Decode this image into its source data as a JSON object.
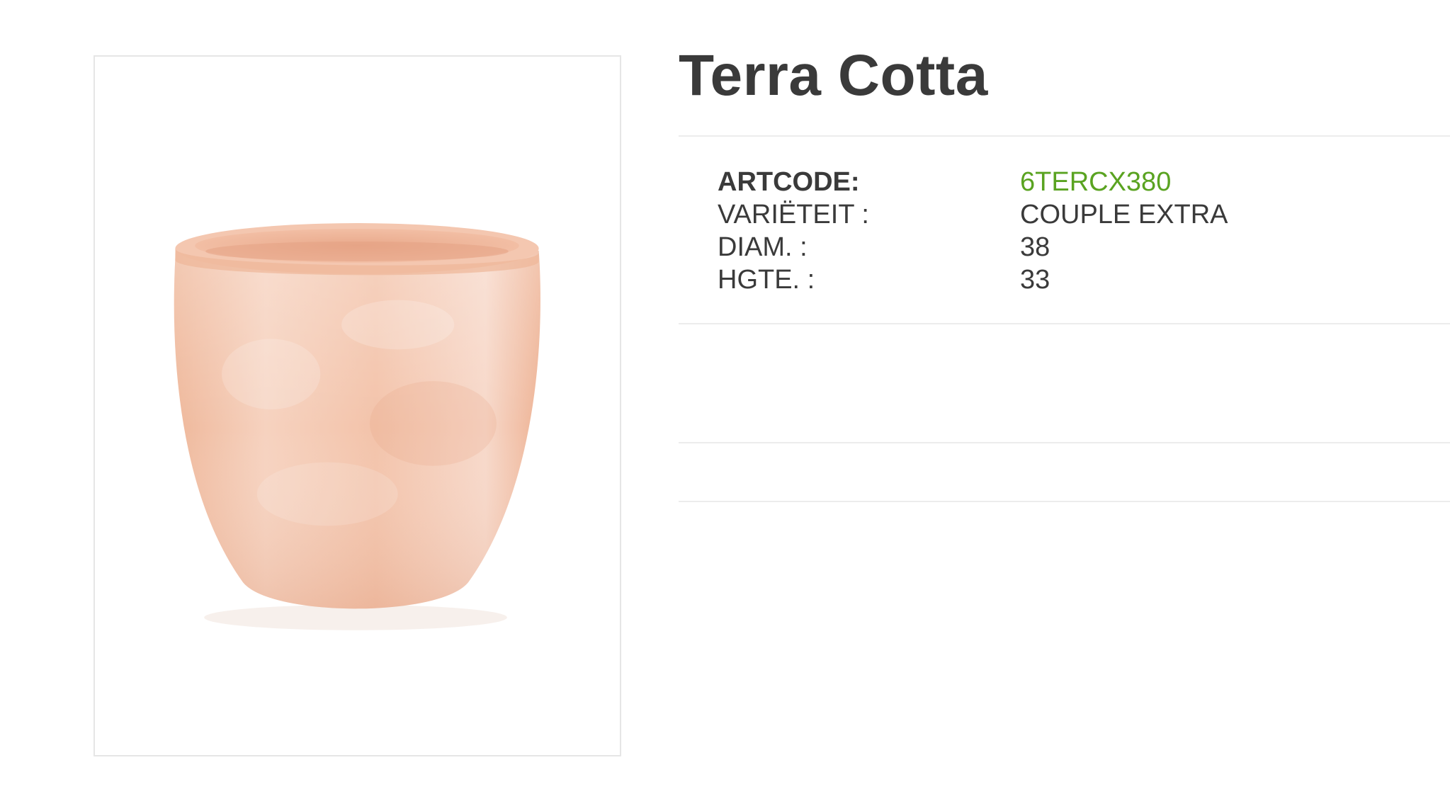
{
  "product": {
    "title": "Terra Cotta",
    "image_alt": "terra cotta pot"
  },
  "specs": [
    {
      "label": "ARTCODE:",
      "value": "6TERCX380"
    },
    {
      "label": "VARIËTEIT :",
      "value": "COUPLE EXTRA"
    },
    {
      "label": "DIAM. :",
      "value": "38"
    },
    {
      "label": "HGTE. :",
      "value": "33"
    }
  ],
  "colors": {
    "accent": "#5aa321",
    "text": "#3a3a3a",
    "divider": "#ececec",
    "pot_body": "#f0b89c",
    "pot_rim": "#f4c7b0"
  }
}
